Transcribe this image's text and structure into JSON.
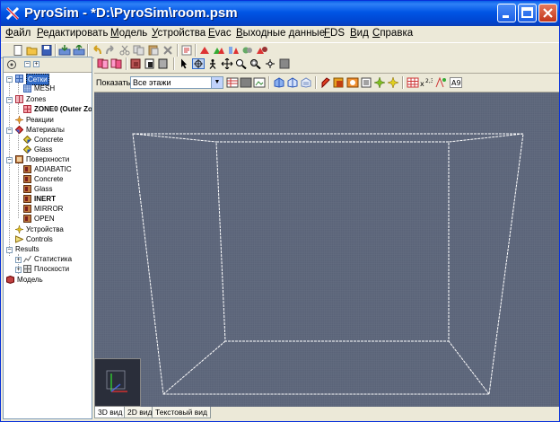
{
  "window": {
    "title": "PyroSim - *D:\\PyroSim\\room.psm"
  },
  "menubar": [
    {
      "label": "Файл",
      "u": "Ф",
      "rest": "айл"
    },
    {
      "label": "Редактировать",
      "u": "Р",
      "rest": "едактировать"
    },
    {
      "label": "Модель",
      "u": "М",
      "rest": "одель"
    },
    {
      "label": "Устройства",
      "u": "У",
      "rest": "стройства"
    },
    {
      "label": "Evac",
      "u": "E",
      "rest": "vac"
    },
    {
      "label": "Выходные данные",
      "u": "В",
      "rest": "ыходные данные"
    },
    {
      "label": "FDS",
      "u": "F",
      "rest": "DS"
    },
    {
      "label": "Вид",
      "u": "В",
      "rest": "ид"
    },
    {
      "label": "Справка",
      "u": "С",
      "rest": "правка"
    }
  ],
  "tree": {
    "meshes": "Сетки",
    "mesh": "MESH",
    "zones": "Zones",
    "zone0": "ZONE0 (Outer Zo",
    "reactions": "Реакции",
    "materials": "Материалы",
    "mat_concrete": "Concrete",
    "mat_glass": "Glass",
    "surfaces": "Поверхности",
    "surf_adiabatic": "ADIABATIC",
    "surf_concrete": "Concrete",
    "surf_glass": "Glass",
    "surf_inert": "INERT",
    "surf_mirror": "MIRROR",
    "surf_open": "OPEN",
    "devices": "Устройства",
    "controls": "Controls",
    "results": "Results",
    "statistics": "Статистика",
    "planes": "Плоскости",
    "model": "Модель"
  },
  "viewbar": {
    "show_label": "Показать:",
    "floor_value": "Все этажи"
  },
  "tabs": {
    "view3d": "3D вид",
    "view2d": "2D вид",
    "text": "Текстовый вид"
  },
  "colors": {
    "viewport_bg": "#5a6378",
    "titlebar": "#0055e5",
    "grid_line": "#6b7487",
    "wireframe": "#ffffff"
  }
}
